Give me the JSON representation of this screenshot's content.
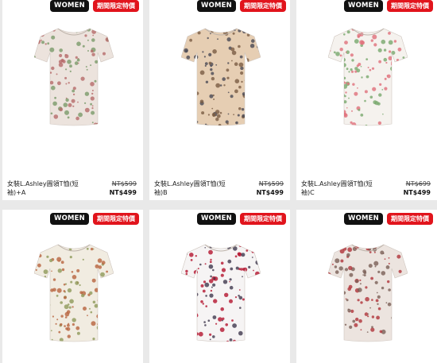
{
  "badges": {
    "women": "WOMEN",
    "sale": "期間限定特價"
  },
  "products": [
    {
      "name": "女裝L.Ashley圓領T恤(短袖)+A",
      "old_price": "NT$599",
      "new_price": "NT$499",
      "base": "#ece3dd",
      "c1": "#b76a6a",
      "c2": "#7a9a6a"
    },
    {
      "name": "女裝L.Ashley圓領T恤(短袖)B",
      "old_price": "NT$599",
      "new_price": "NT$499",
      "base": "#e6ceb3",
      "c1": "#7a5c44",
      "c2": "#4a4a55"
    },
    {
      "name": "女裝L.Ashley圓領T恤(短袖)C",
      "old_price": "NT$699",
      "new_price": "NT$499",
      "base": "#f5f2ee",
      "c1": "#e06f7a",
      "c2": "#78a86d"
    },
    {
      "name": "",
      "old_price": "",
      "new_price": "",
      "base": "#f1ece1",
      "c1": "#b8643f",
      "c2": "#8f9a5a"
    },
    {
      "name": "",
      "old_price": "",
      "new_price": "",
      "base": "#f6f4f4",
      "c1": "#b4142e",
      "c2": "#40384e"
    },
    {
      "name": "",
      "old_price": "",
      "new_price": "",
      "base": "#ece4df",
      "c1": "#b0333a",
      "c2": "#7a5f56"
    }
  ]
}
